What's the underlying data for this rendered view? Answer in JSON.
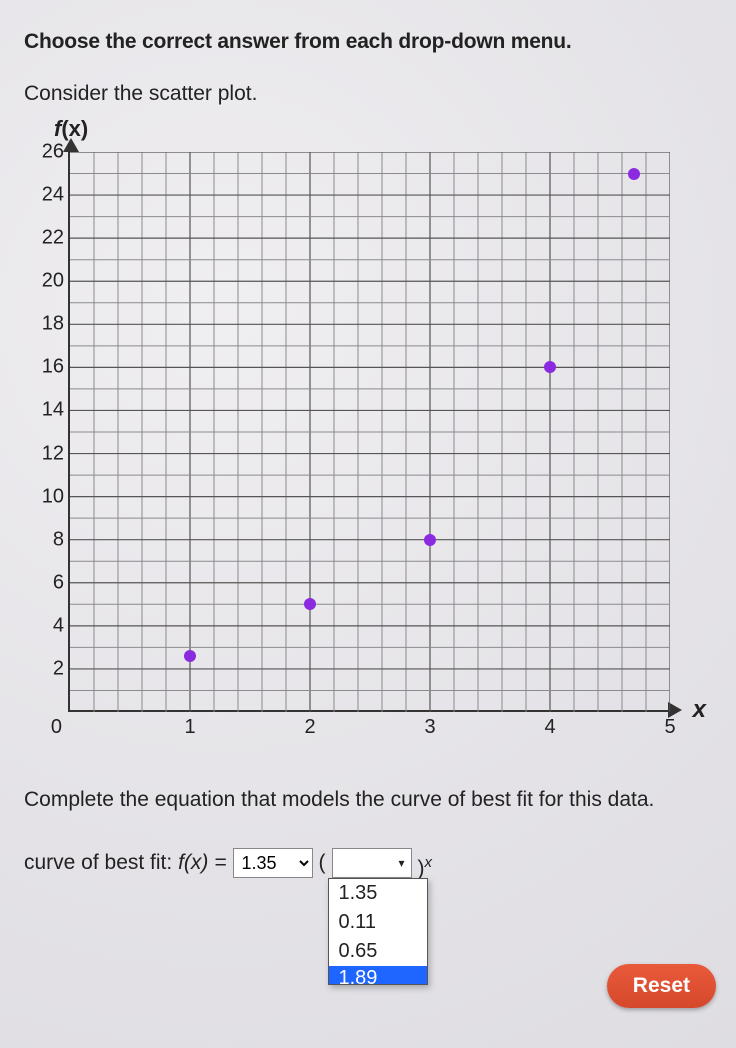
{
  "instruction": "Choose the correct answer from each drop-down menu.",
  "subhead": "Consider the scatter plot.",
  "ylabel_f": "f",
  "ylabel_x": "(x)",
  "xlabel": "x",
  "below": "Complete the equation that models the curve of best fit for this data.",
  "eq": {
    "prefix": "curve of best fit: ",
    "fx": "f(x) = ",
    "select1_value": "1.35",
    "open_paren": " (",
    "close_paren": ")",
    "exp": "x"
  },
  "dropdown2": {
    "options": [
      "1.35",
      "0.11",
      "0.65",
      "1.89"
    ],
    "highlighted_index": 3
  },
  "reset_label": "Reset",
  "chart_data": {
    "type": "scatter",
    "title": "",
    "xlabel": "x",
    "ylabel": "f(x)",
    "xlim": [
      0,
      5
    ],
    "ylim": [
      0,
      26
    ],
    "x_ticks": [
      1,
      2,
      3,
      4,
      5
    ],
    "y_ticks": [
      2,
      4,
      6,
      8,
      10,
      12,
      14,
      16,
      18,
      20,
      22,
      24,
      26
    ],
    "points": [
      {
        "x": 1,
        "y": 2.6
      },
      {
        "x": 2,
        "y": 5
      },
      {
        "x": 3,
        "y": 8
      },
      {
        "x": 4,
        "y": 16
      },
      {
        "x": 4.7,
        "y": 25
      }
    ],
    "grid": true
  }
}
